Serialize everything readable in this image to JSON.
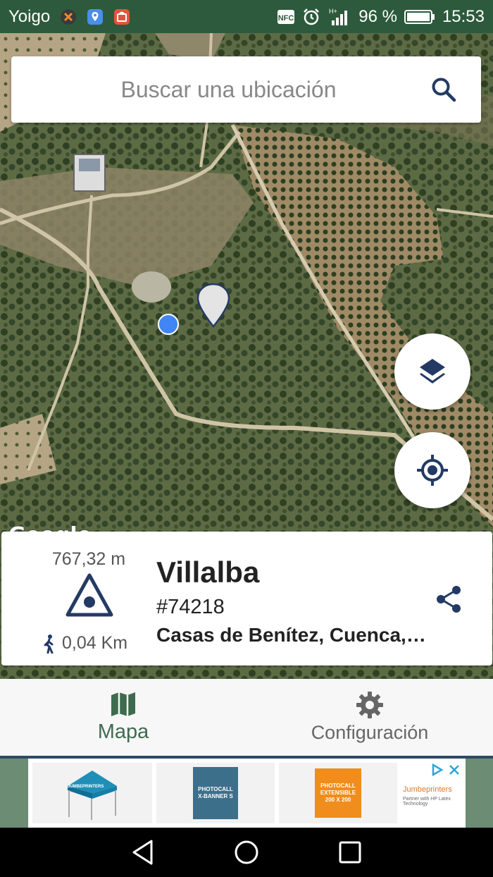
{
  "status_bar": {
    "carrier": "Yoigo",
    "nfc": "NFC",
    "network": "H+",
    "battery": "96 %",
    "time": "15:53",
    "notification_icons": [
      "app-icon-orange",
      "maps-icon",
      "app-icon-red"
    ]
  },
  "map": {
    "attribution": "Google"
  },
  "search": {
    "placeholder": "Buscar una ubicación"
  },
  "fabs": {
    "layers_icon": "layers-icon",
    "location_icon": "my-location-icon"
  },
  "info_card": {
    "elevation": "767,32 m",
    "distance": "0,04 Km",
    "name": "Villalba",
    "id": "#74218",
    "region": "Casas de Benítez, Cuenca, Castilla-La Mancha"
  },
  "bottom_nav": {
    "items": [
      {
        "label": "Mapa",
        "icon": "map-icon",
        "active": true
      },
      {
        "label": "Configuración",
        "icon": "gear-icon",
        "active": false
      }
    ]
  },
  "ad": {
    "tiles": [
      {
        "text": "JUMBEPRINTERS"
      },
      {
        "text": "PHOTOCALL X-BANNER S"
      },
      {
        "text": "PHOTOCALL EXTENSIBLE 200 X 200"
      }
    ],
    "brand": "Jumbeprinters",
    "brand_sub": "Partner with HP Latex Technology"
  },
  "colors": {
    "status_bar": "#2d5a3c",
    "accent": "#3f6b4f",
    "peak_icon": "#243a64"
  }
}
